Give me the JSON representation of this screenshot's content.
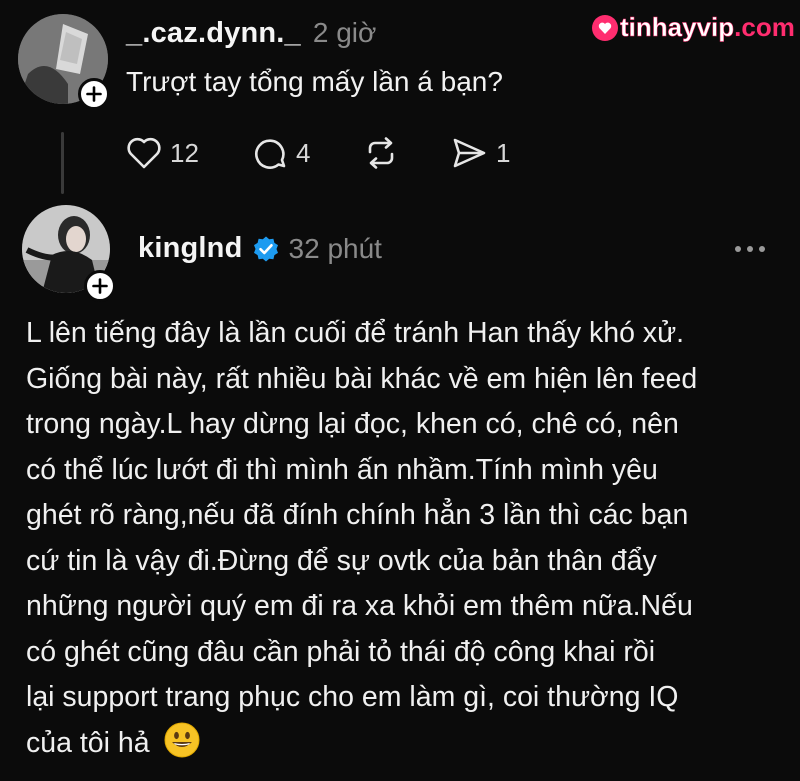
{
  "watermark": {
    "brand": "tinhayvip",
    "tld": ".com"
  },
  "first_post": {
    "username": "_.caz.dynn._",
    "time": "2 giờ",
    "text": "Trượt tay tổng mấy lần á bạn?",
    "actions": {
      "like_count": "12",
      "comment_count": "4",
      "repost_count": "",
      "share_count": "1"
    },
    "icons": [
      "plus-icon",
      "heart-icon",
      "comment-icon",
      "repost-icon",
      "share-icon"
    ]
  },
  "second_post": {
    "username": "kinglnd",
    "verified": true,
    "time": "32 phút",
    "lines": [
      "L lên tiếng đây là lần cuối để tránh Han thấy khó xử.",
      "Giống bài này, rất nhiều bài khác về em hiện lên feed",
      "trong ngày.L hay dừng lại đọc, khen có, chê có, nên",
      "có thể lúc lướt đi thì mình ấn nhầm.Tính mình yêu",
      "ghét rõ ràng,nếu đã đính chính hẳn 3 lần thì các bạn",
      "cứ tin là vậy đi.Đừng để sự ovtk của bản thân đẩy",
      "những người quý em đi ra xa khỏi em thêm nữa.Nếu",
      "có ghét cũng đâu cần phải tỏ thái độ công khai rồi",
      "lại support trang phục cho em làm gì, coi thường IQ",
      "của tôi hả"
    ],
    "emoji": "😃"
  },
  "colors": {
    "background": "#0b0b0b",
    "muted": "#8a8a8a",
    "verified": "#1d9bf0",
    "watermark": "#ff2d6f"
  }
}
